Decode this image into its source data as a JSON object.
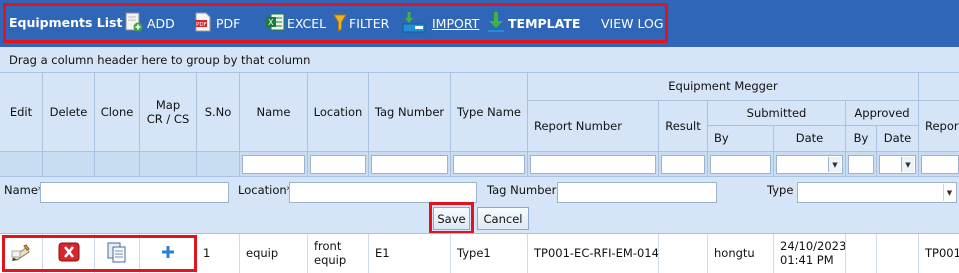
{
  "toolbar": {
    "title": "Equipments List",
    "items": [
      {
        "label": "ADD",
        "icon": "add-document-icon"
      },
      {
        "label": "PDF",
        "icon": "pdf-icon"
      },
      {
        "label": "EXCEL",
        "icon": "excel-icon"
      },
      {
        "label": "FILTER",
        "icon": "filter-icon"
      },
      {
        "label": "IMPORT",
        "icon": "import-icon"
      },
      {
        "label": "TEMPLATE",
        "icon": "download-arrow-icon"
      },
      {
        "label": "VIEW LOG"
      }
    ]
  },
  "group_panel": {
    "text": "Drag a column header here to group by that column"
  },
  "grid": {
    "headers": {
      "edit": "Edit",
      "delete": "Delete",
      "clone": "Clone",
      "map": "Map\nCR / CS",
      "sno": "S.No",
      "name": "Name",
      "location": "Location",
      "tag_number": "Tag Number",
      "type_name": "Type Name",
      "equipment_megger": "Equipment Megger",
      "report_number": "Report Number",
      "result": "Result",
      "submitted": "Submitted",
      "submitted_by": "By",
      "submitted_date": "Date",
      "approved": "Approved",
      "approved_by": "By",
      "approved_date": "Date",
      "report_cut": "Repor"
    },
    "rows": [
      {
        "sno": "1",
        "name": "equip",
        "location": "front\nequip",
        "tag_number": "E1",
        "type_name": "Type1",
        "report_number": "TP001-EC-RFI-EM-014",
        "result": "",
        "submitted_by": "hongtu",
        "submitted_date": "24/10/2023\n01:41 PM",
        "approved_by": "",
        "approved_date": "",
        "report_cut": "TP001"
      }
    ]
  },
  "edit_form": {
    "name_label": "Name*",
    "location_label": "Location*",
    "tag_number_label": "Tag Number",
    "type_label": "Type",
    "name_value": "",
    "location_value": "",
    "tag_number_value": "",
    "type_value": "",
    "save_label": "Save",
    "cancel_label": "Cancel"
  },
  "colors": {
    "toolbar_bg": "#2f66b8",
    "header_bg": "#d5e5f7",
    "highlight": "#e0141e"
  }
}
